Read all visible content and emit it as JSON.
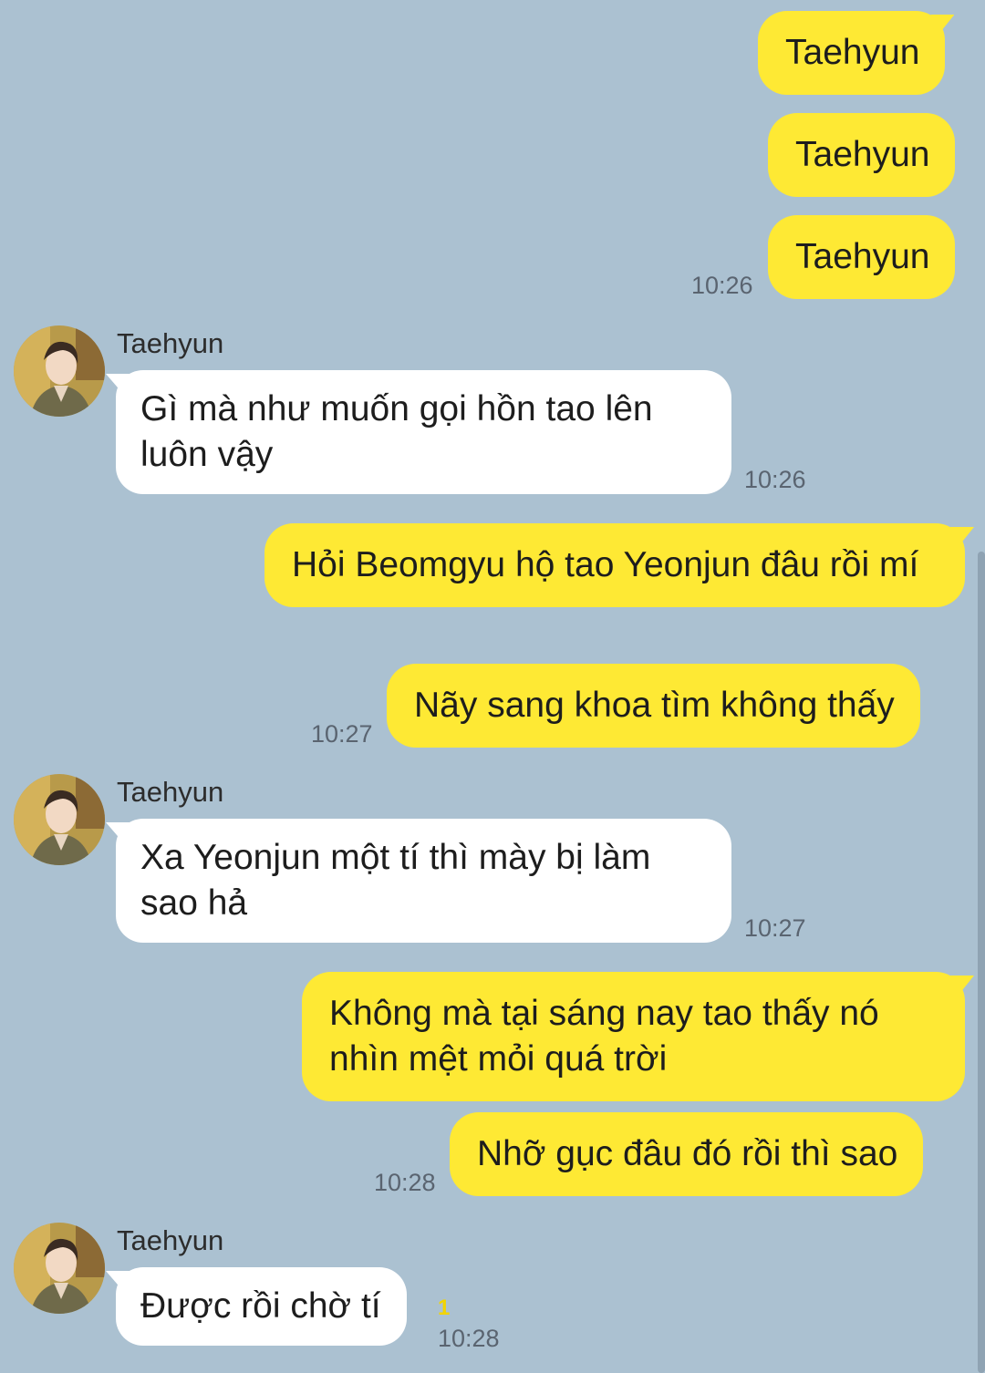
{
  "chat": {
    "messages": [
      {
        "text": "Taehyun"
      },
      {
        "text": "Taehyun"
      },
      {
        "text": "Taehyun",
        "time": "10:26"
      },
      {
        "sender": "Taehyun",
        "text": "Gì mà như muốn gọi hồn tao lên luôn vậy",
        "time": "10:26"
      },
      {
        "text": "Hỏi Beomgyu hộ tao Yeonjun đâu rồi mí"
      },
      {
        "text": "Nãy sang khoa tìm không thấy",
        "time": "10:27"
      },
      {
        "sender": "Taehyun",
        "text": "Xa Yeonjun một tí thì mày bị làm sao hả",
        "time": "10:27"
      },
      {
        "text": "Không mà tại sáng nay tao thấy nó nhìn mệt mỏi quá trời"
      },
      {
        "text": "Nhỡ gục đâu đó rồi thì sao",
        "time": "10:28"
      },
      {
        "sender": "Taehyun",
        "text": "Được rồi chờ tí",
        "time": "10:28",
        "unread": "1"
      }
    ]
  },
  "colors": {
    "background": "#abc1d1",
    "outgoing_bubble": "#fee934",
    "incoming_bubble": "#ffffff",
    "unread_count": "#f2d400"
  }
}
